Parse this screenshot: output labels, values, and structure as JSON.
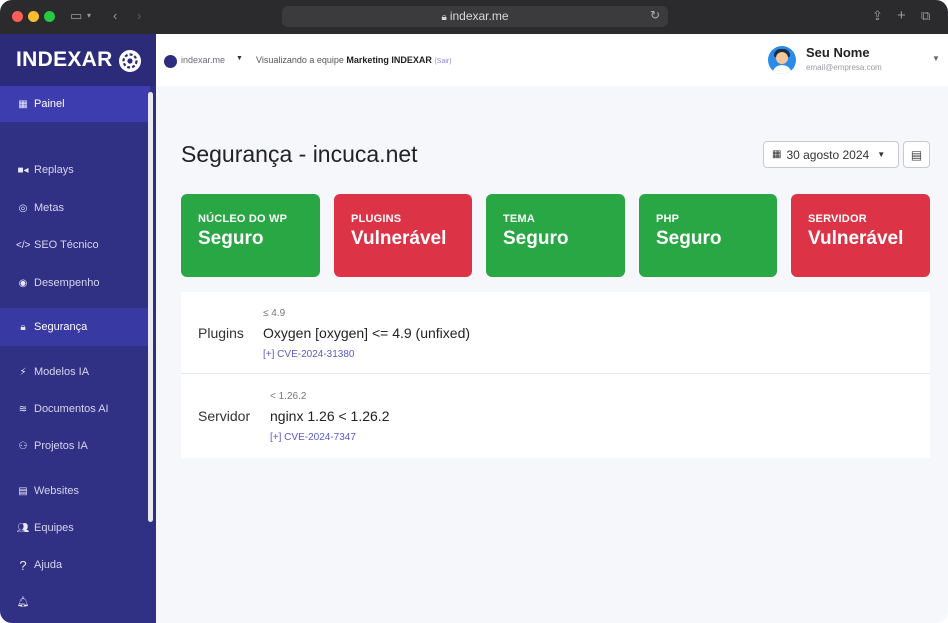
{
  "browser": {
    "url": "indexar.me"
  },
  "sidebar": {
    "brand": "INDEXAR",
    "items": [
      {
        "label": "Painel",
        "icon": "dashboard-icon"
      },
      {
        "label": "Replays",
        "icon": "video-icon"
      },
      {
        "label": "Metas",
        "icon": "target-icon"
      },
      {
        "label": "SEO Técnico",
        "icon": "code-icon"
      },
      {
        "label": "Desempenho",
        "icon": "gauge-icon"
      },
      {
        "label": "Segurança",
        "icon": "lock-icon"
      },
      {
        "label": "Modelos IA",
        "icon": "magic-icon"
      },
      {
        "label": "Documentos AI",
        "icon": "layers-icon"
      },
      {
        "label": "Projetos IA",
        "icon": "project-diagram-icon"
      },
      {
        "label": "Websites",
        "icon": "server-icon"
      },
      {
        "label": "Equipes",
        "icon": "users-icon"
      },
      {
        "label": "Ajuda",
        "icon": "question-icon"
      }
    ]
  },
  "topbar": {
    "team_domain": "indexar.me",
    "viewing_prefix": "Visualizando a equipe",
    "team_name": "Marketing INDEXAR",
    "exit_label": "(Sair)",
    "user_name": "Seu Nome",
    "user_email": "email@empresa.com"
  },
  "page": {
    "title": "Segurança - incuca.net",
    "date": "30 agosto 2024"
  },
  "status_cards": [
    {
      "label": "NÚCLEO DO WP",
      "value": "Seguro",
      "status": "green"
    },
    {
      "label": "PLUGINS",
      "value": "Vulnerável",
      "status": "red"
    },
    {
      "label": "TEMA",
      "value": "Seguro",
      "status": "green"
    },
    {
      "label": "PHP",
      "value": "Seguro",
      "status": "green"
    },
    {
      "label": "SERVIDOR",
      "value": "Vulnerável",
      "status": "red"
    }
  ],
  "vulnerabilities": [
    {
      "category": "Plugins",
      "version": "≤ 4.9",
      "title": "Oxygen [oxygen] <= 4.9 (unfixed)",
      "cve": "[+] CVE-2024-31380"
    },
    {
      "category": "Servidor",
      "version": "< 1.26.2",
      "title": "nginx 1.26 < 1.26.2",
      "cve": "[+] CVE-2024-7347"
    }
  ],
  "colors": {
    "sidebar_bg": "#303084",
    "safe_green": "#29a745",
    "vulnerable_red": "#dc3446",
    "link_blue": "#5a5ad0"
  }
}
